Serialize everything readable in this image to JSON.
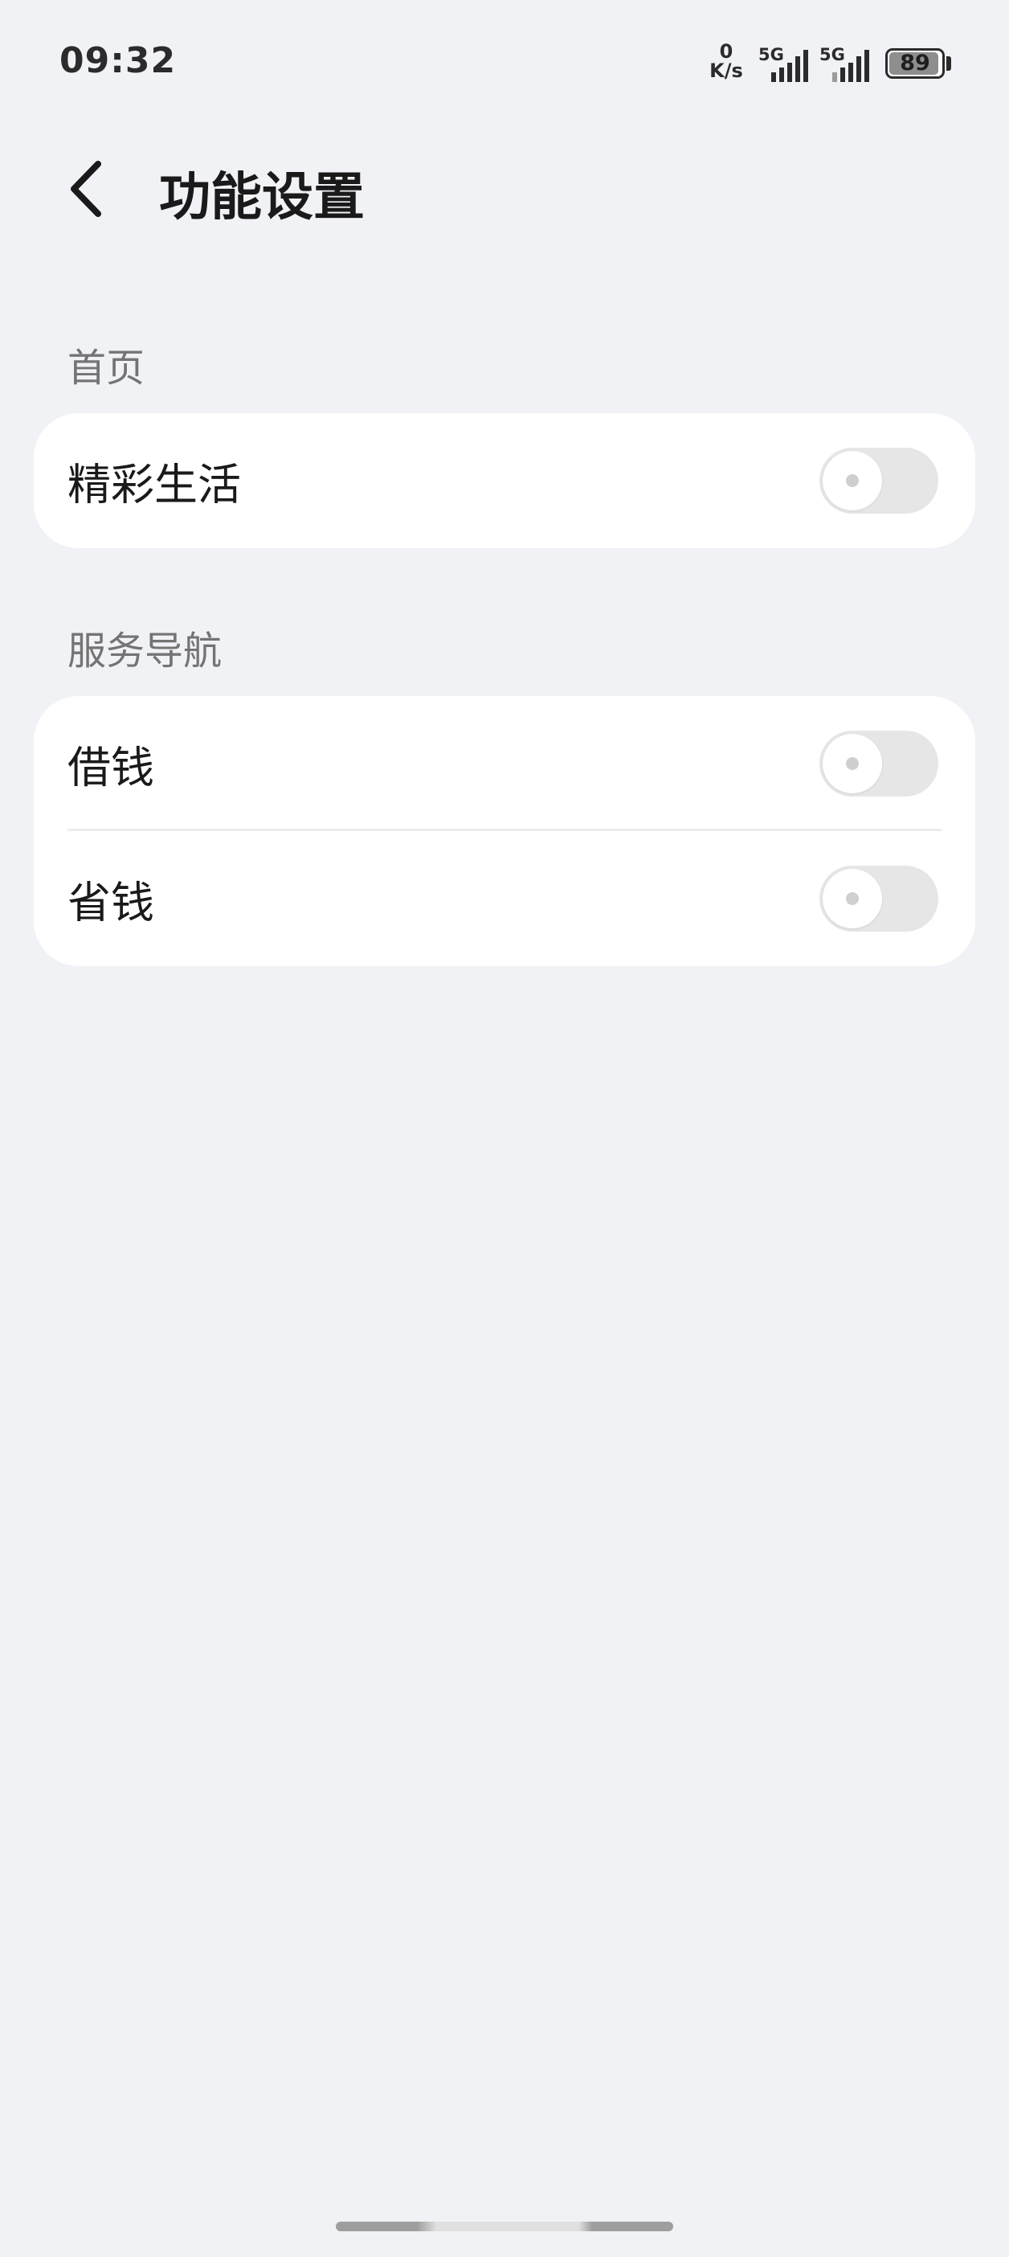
{
  "status_bar": {
    "time": "09:32",
    "net_speed_value": "0",
    "net_speed_unit": "K/s",
    "signal_1_label": "5G",
    "signal_2_label": "5G",
    "battery_level": "89"
  },
  "header": {
    "back_icon": "chevron-left-icon",
    "title": "功能设置"
  },
  "sections": [
    {
      "title": "首页",
      "items": [
        {
          "label": "精彩生活",
          "enabled": false
        }
      ]
    },
    {
      "title": "服务导航",
      "items": [
        {
          "label": "借钱",
          "enabled": false
        },
        {
          "label": "省钱",
          "enabled": false
        }
      ]
    }
  ],
  "colors": {
    "background": "#f1f2f6",
    "card": "#ffffff",
    "toggle_off": "#e6e6e6"
  }
}
